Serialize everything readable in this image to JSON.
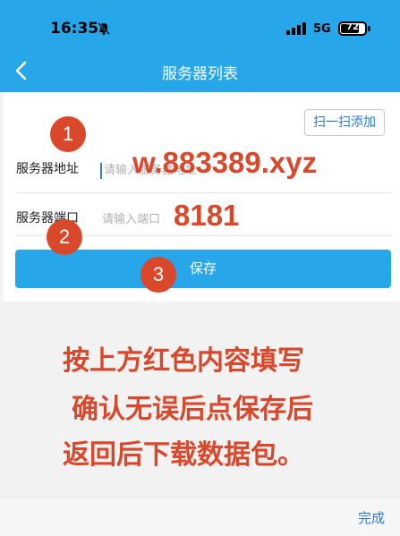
{
  "status_bar": {
    "time": "16:35",
    "network": "5G",
    "battery": "72"
  },
  "nav": {
    "title": "服务器列表"
  },
  "form": {
    "scan_button": "扫一扫添加",
    "address_label": "服务器地址",
    "address_placeholder": "请输入服务器地址",
    "port_label": "服务器端口",
    "port_placeholder": "请输入端口",
    "save_button": "保存"
  },
  "annotations": {
    "step1": "1",
    "step2": "2",
    "step3": "3",
    "address_value": "w.883389.xyz",
    "port_value": "8181"
  },
  "instructions": {
    "line1": "按上方红色内容填写",
    "line2": "确认无误后点保存后",
    "line3": "返回后下载数据包。"
  },
  "keyboard_toolbar": {
    "done": "完成"
  },
  "colors": {
    "primary": "#27a7ea",
    "annotation": "#d9482b",
    "link": "#2a7bd6"
  }
}
